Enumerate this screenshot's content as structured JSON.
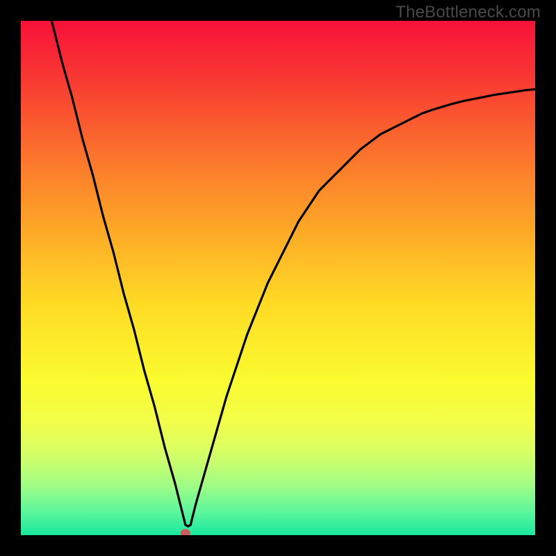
{
  "watermark": "TheBottleneck.com",
  "chart_data": {
    "type": "line",
    "title": "",
    "xlabel": "",
    "ylabel": "",
    "xlim": [
      0,
      100
    ],
    "ylim": [
      0,
      100
    ],
    "minimum_x": 32,
    "marker": {
      "x": 32,
      "y": 0,
      "color": "#cd5c5c"
    },
    "series": [
      {
        "name": "curve",
        "x": [
          6,
          8,
          10,
          12,
          14,
          16,
          18,
          20,
          22,
          24,
          26,
          28,
          30,
          31,
          32,
          32.5,
          33,
          34,
          36,
          38,
          40,
          42,
          44,
          46,
          48,
          50,
          52,
          54,
          56,
          58,
          60,
          62,
          64,
          66,
          68,
          70,
          72,
          74,
          76,
          78,
          80,
          82,
          84,
          86,
          88,
          90,
          92,
          94,
          96,
          98,
          100
        ],
        "y": [
          100,
          92,
          85,
          77,
          70,
          62,
          55,
          47,
          40,
          32,
          25,
          17,
          10,
          6,
          2,
          1.7,
          2,
          6,
          13,
          20,
          27,
          33,
          39,
          44,
          49,
          53,
          57,
          61,
          64,
          67,
          69,
          71,
          73,
          75,
          76.5,
          78,
          79,
          80,
          81,
          82,
          82.7,
          83.3,
          83.9,
          84.4,
          84.8,
          85.2,
          85.6,
          85.9,
          86.2,
          86.5,
          86.7
        ]
      }
    ],
    "background_gradient": {
      "stops": [
        {
          "offset": 0.0,
          "color": "#f71139"
        },
        {
          "offset": 0.1,
          "color": "#f83433"
        },
        {
          "offset": 0.25,
          "color": "#fb6f2d"
        },
        {
          "offset": 0.4,
          "color": "#fda627"
        },
        {
          "offset": 0.55,
          "color": "#fedb25"
        },
        {
          "offset": 0.7,
          "color": "#fafb2f"
        },
        {
          "offset": 0.78,
          "color": "#f2fe4a"
        },
        {
          "offset": 0.84,
          "color": "#d7fe66"
        },
        {
          "offset": 0.9,
          "color": "#a4fd84"
        },
        {
          "offset": 0.95,
          "color": "#63f79a"
        },
        {
          "offset": 1.0,
          "color": "#19e9a0"
        }
      ]
    }
  }
}
